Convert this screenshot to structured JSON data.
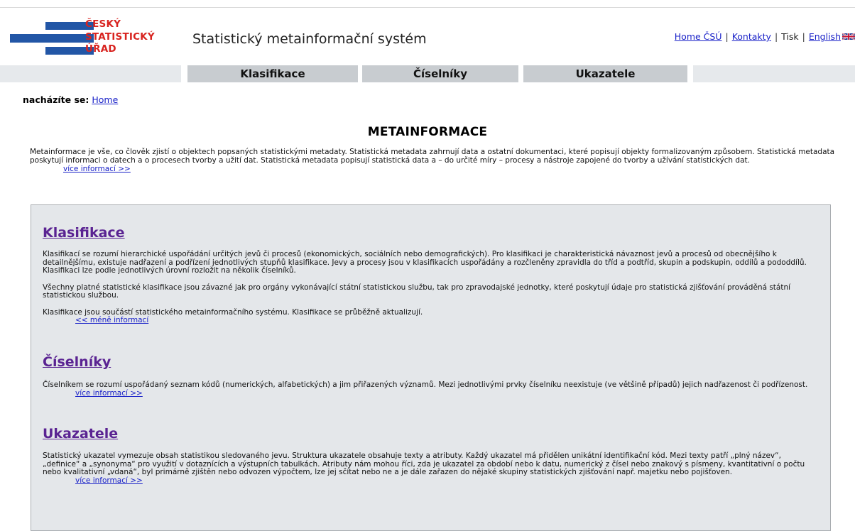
{
  "logo": {
    "line1": "ČESKÝ",
    "line2": "STATISTICKÝ",
    "line3": "ÚŘAD",
    "bar_color": "#2256a6",
    "text_color": "#d8231f"
  },
  "header": {
    "site_title": "Statistický metainformační systém",
    "links": {
      "home": "Home ČSÚ",
      "contacts": "Kontakty",
      "print": "Tisk",
      "english": "English"
    },
    "separator": "|"
  },
  "nav": {
    "tabs": [
      "Klasifikace",
      "Číselníky",
      "Ukazatele"
    ]
  },
  "breadcrumb": {
    "label": "nacházíte se:",
    "home": "Home"
  },
  "main": {
    "heading": "METAINFORMACE",
    "intro": "Metainformace je vše, co člověk zjistí o objektech popsaných statistickými metadaty. Statistická metadata zahrnují data a ostatní dokumentaci, které popisují objekty formalizovaným způsobem. Statistická metadata poskytují informaci o datech a o procesech tvorby a užití dat. Statistická metadata popisují statistická data a – do určité míry – procesy a nástroje zapojené do tvorby a užívání statistických dat.",
    "intro_more": "více informací >>"
  },
  "sections": {
    "klasifikace": {
      "title": "Klasifikace",
      "p1": "Klasifikací se rozumí hierarchické uspořádání určitých jevů či procesů (ekonomických, sociálních nebo demografických). Pro klasifikaci je charakteristická návaznost jevů a procesů od obecnějšího k detailnějšímu, existuje nadřazení a podřízení jednotlivých stupňů klasifikace. Jevy a procesy jsou v klasifikacích uspořádány a rozčleněny zpravidla do tříd a podtříd, skupin a podskupin, oddílů a pododdílů. Klasifikaci lze podle jednotlivých úrovní rozložit na několik číselníků.",
      "p2": "Všechny platné statistické klasifikace jsou závazné jak pro orgány vykonávající státní statistickou službu, tak pro zpravodajské jednotky, které poskytují údaje pro statistická zjišťování prováděná státní statistickou službou.",
      "p3": "Klasifikace jsou součástí statistického metainformačního systému. Klasifikace se průběžně aktualizují.",
      "less": "<< méně informací"
    },
    "ciselniky": {
      "title": "Číselníky",
      "p1": "Číselníkem se rozumí uspořádaný seznam kódů (numerických, alfabetických) a jim přiřazených významů. Mezi jednotlivými prvky číselníku neexistuje (ve většině případů) jejich nadřazenost či podřízenost.",
      "more": "více informací >>"
    },
    "ukazatele": {
      "title": "Ukazatele",
      "p1": "Statistický ukazatel vymezuje obsah statistikou sledovaného jevu. Struktura ukazatele obsahuje texty a atributy. Každý ukazatel má přidělen unikátní identifikační kód. Mezi texty patří „plný název“, „definice“ a „synonyma“ pro využití v dotaznících a výstupních tabulkách. Atributy nám mohou říci, zda je ukazatel za období nebo k datu, numerický z čísel nebo znakový s písmeny, kvantitativní o počtu nebo kvalitativní „vdaná“, byl primárně zjištěn nebo odvozen výpočtem, lze jej sčítat nebo ne a je dále zařazen do nějaké skupiny statistických zjišťování např. majetku nebo pojišťoven.",
      "more": "více informací >>"
    }
  }
}
